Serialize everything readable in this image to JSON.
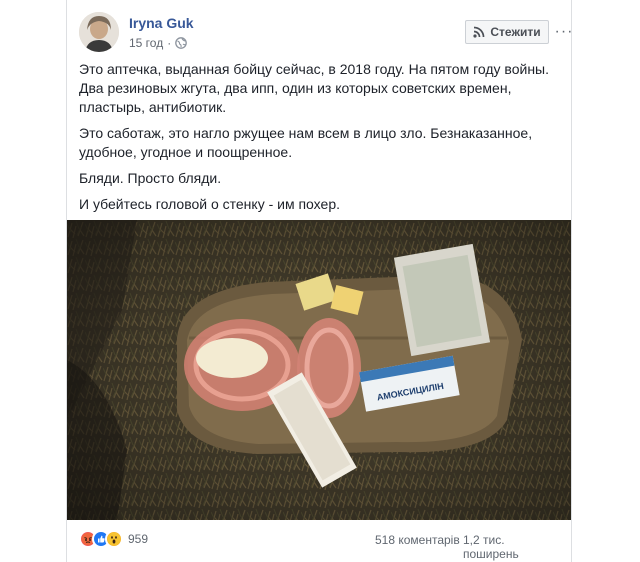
{
  "post": {
    "author": "Iryna Guk",
    "time": "15 год",
    "time_separator": "·",
    "privacy_icon": "globe-icon",
    "follow_label": "Стежити",
    "follow_icon": "rss-icon",
    "more_label": "···",
    "paragraphs": [
      "Это аптечка, выданная бойцу сейчас, в 2018 году. На пятом году войны. Два резиновых жгута, два ипп, один из которых советских времен, пластырь, антибиотик.",
      "Это саботаж, это нагло ржущее нам всем в лицо зло. Безнаказанное, удобное, угодное и поощренное.",
      "Бляди. Просто бляди.",
      "И убейтесь головой о стенку - им похер."
    ],
    "photo_label": "АМОКСИЦИЛІН",
    "reactions": {
      "icons": [
        "angry-icon",
        "like-icon",
        "wow-icon"
      ],
      "count": "959"
    },
    "comments": "518 коментарів",
    "shares": "1,2 тис. поширень"
  }
}
